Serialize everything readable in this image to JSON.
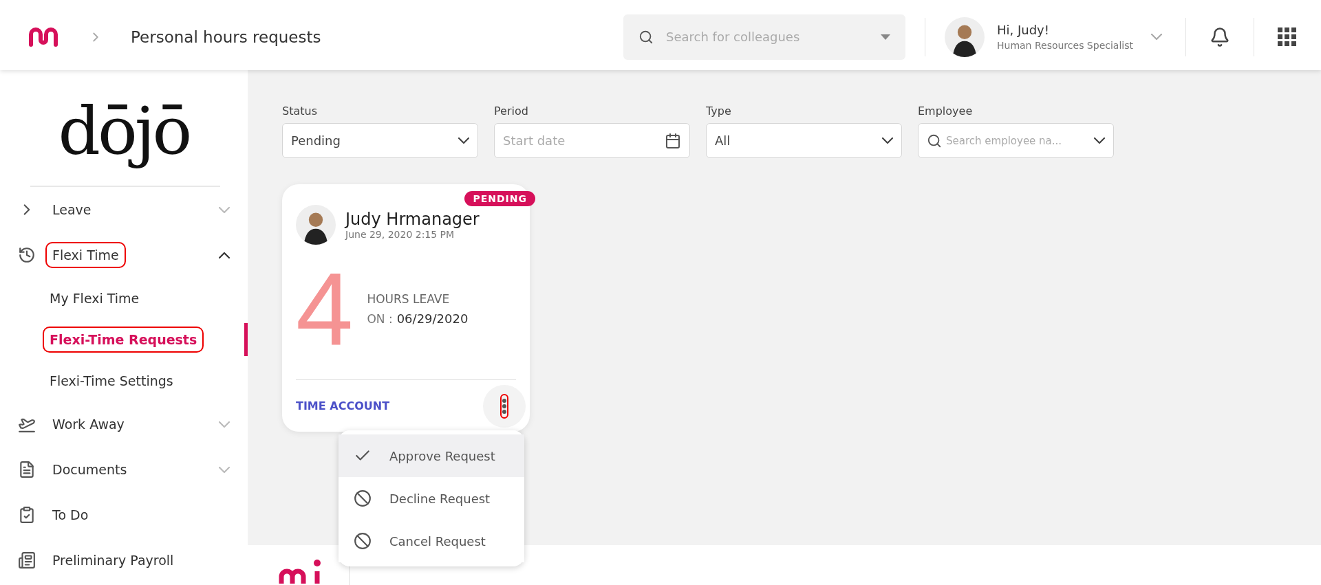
{
  "header": {
    "breadcrumb": "Personal hours requests",
    "search": {
      "placeholder": "Search for colleagues"
    },
    "user": {
      "greeting": "Hi, Judy!",
      "role": "Human Resources Specialist"
    }
  },
  "sidebar": {
    "logo": "dōjō",
    "items": [
      {
        "label": "Leave",
        "kind": "leave",
        "expanded": false,
        "annotated": false
      },
      {
        "label": "Flexi Time",
        "kind": "flexi",
        "expanded": true,
        "annotated": true,
        "children": [
          {
            "label": "My Flexi Time",
            "selected": false,
            "annotated": false
          },
          {
            "label": "Flexi-Time Requests",
            "selected": true,
            "annotated": true
          },
          {
            "label": "Flexi-Time Settings",
            "selected": false,
            "annotated": false
          }
        ]
      },
      {
        "label": "Work Away",
        "kind": "plane",
        "expanded": false,
        "annotated": false
      },
      {
        "label": "Documents",
        "kind": "document",
        "expanded": false,
        "annotated": false
      },
      {
        "label": "To Do",
        "kind": "todo",
        "annotated": false
      },
      {
        "label": "Preliminary Payroll",
        "kind": "payroll",
        "annotated": false
      }
    ]
  },
  "filters": [
    {
      "label": "Status",
      "kind": "select",
      "value": "Pending"
    },
    {
      "label": "Period",
      "kind": "date",
      "placeholder": "Start date"
    },
    {
      "label": "Type",
      "kind": "select",
      "value": "All"
    },
    {
      "label": "Employee",
      "kind": "search",
      "placeholder": "Search employee na..."
    }
  ],
  "request_card": {
    "status": "PENDING",
    "name": "Judy Hrmanager",
    "timestamp": "June 29, 2020 2:15 PM",
    "hours": "4",
    "hours_label": "HOURS LEAVE",
    "on_label": "ON :",
    "date": "06/29/2020",
    "account_link": "TIME ACCOUNT",
    "menu_annotated": true
  },
  "menu": [
    {
      "label": "Approve Request",
      "kind": "approve",
      "selected": true
    },
    {
      "label": "Decline Request",
      "kind": "decline",
      "selected": false
    },
    {
      "label": "Cancel Request",
      "kind": "cancel",
      "selected": false
    }
  ]
}
